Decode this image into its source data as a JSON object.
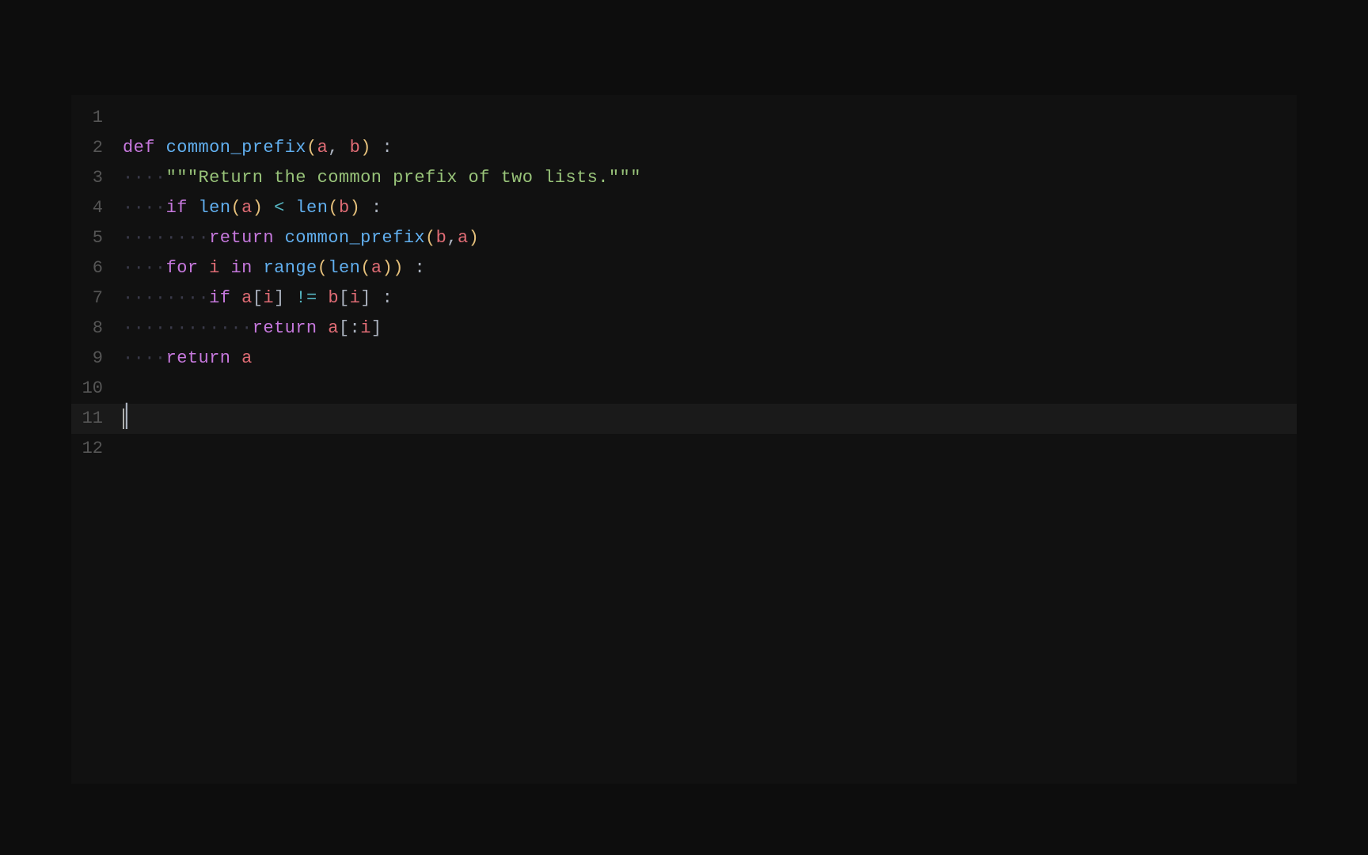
{
  "editor": {
    "background": "#0d0d0d",
    "line_height": 38,
    "font_size": 22
  },
  "lines": [
    {
      "number": "1",
      "content": ""
    },
    {
      "number": "2",
      "content": "def common_prefix(a, b) :"
    },
    {
      "number": "3",
      "content": "    \"\"\"Return the common prefix of two lists.\"\"\""
    },
    {
      "number": "4",
      "content": "    if len(a) < len(b) :"
    },
    {
      "number": "5",
      "content": "        return common_prefix(b,a)"
    },
    {
      "number": "6",
      "content": "    for i in range(len(a)) :"
    },
    {
      "number": "7",
      "content": "        if a[i] != b[i] :"
    },
    {
      "number": "8",
      "content": "            return a[:i]"
    },
    {
      "number": "9",
      "content": "    return a"
    },
    {
      "number": "10",
      "content": ""
    },
    {
      "number": "11",
      "content": ""
    },
    {
      "number": "12",
      "content": ""
    }
  ],
  "indent_dots": "·····",
  "indent_dots2": "··········",
  "indent_dots3": "···············",
  "indent_dots4": "····················"
}
